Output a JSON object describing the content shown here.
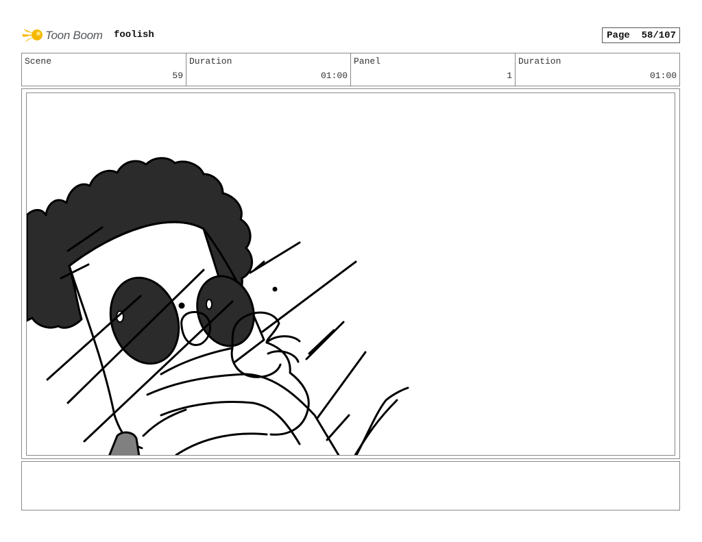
{
  "header": {
    "logo_text": "Toon Boom",
    "project_name": "foolish",
    "page_label": "Page",
    "page_value": "58/107"
  },
  "info": {
    "scene_label": "Scene",
    "scene_value": "59",
    "scene_duration_label": "Duration",
    "scene_duration_value": "01:00",
    "panel_label": "Panel",
    "panel_value": "1",
    "panel_duration_label": "Duration",
    "panel_duration_value": "01:00"
  },
  "colors": {
    "logo_accent": "#f5b800",
    "ink": "#000000",
    "fill_dark": "#2b2b2b",
    "fill_gray": "#808080"
  },
  "icons": {
    "logo": "toon-boom-logo-icon"
  }
}
